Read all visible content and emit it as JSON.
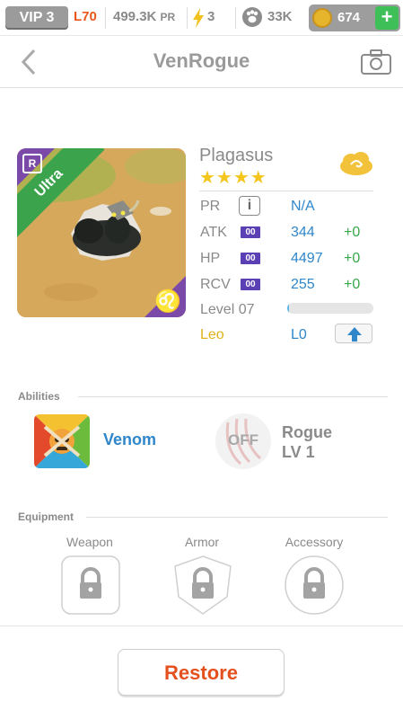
{
  "statusbar": {
    "vip": "VIP 3",
    "level": "L70",
    "pr_value": "499.3K",
    "pr_unit": "PR",
    "energy": "3",
    "food": "33K",
    "coins": "674",
    "add": "+"
  },
  "header": {
    "title": "VenRogue"
  },
  "monster": {
    "name": "Plagasus",
    "stars": "★★★★",
    "rarity": "Ultra",
    "rarity_badge": "R",
    "zodiac_symbol": "♌",
    "level_progress": 0.02,
    "colors": {
      "rarity_green": "#3ba34c",
      "zodiac_purple": "#7b4aa8",
      "value_blue": "#2f86c9",
      "bonus_green": "#38a84a"
    }
  },
  "stats": {
    "pr_label": "PR",
    "pr_info": "i",
    "pr_value": "N/A",
    "rows": [
      {
        "label": "ATK",
        "badge": "00",
        "value": "344",
        "bonus": "+0"
      },
      {
        "label": "HP",
        "badge": "00",
        "value": "4497",
        "bonus": "+0"
      },
      {
        "label": "RCV",
        "badge": "00",
        "value": "255",
        "bonus": "+0"
      }
    ],
    "level_label": "Level 07",
    "zodiac_label": "Leo",
    "zodiac_level": "L0"
  },
  "abilities": {
    "heading": "Abilities",
    "items": [
      {
        "name": "Venom"
      },
      {
        "state": "OFF",
        "name": "Rogue",
        "level": "LV 1"
      }
    ]
  },
  "equipment": {
    "heading": "Equipment",
    "slots": [
      {
        "label": "Weapon"
      },
      {
        "label": "Armor"
      },
      {
        "label": "Accessory"
      }
    ]
  },
  "footer": {
    "restore_label": "Restore"
  }
}
